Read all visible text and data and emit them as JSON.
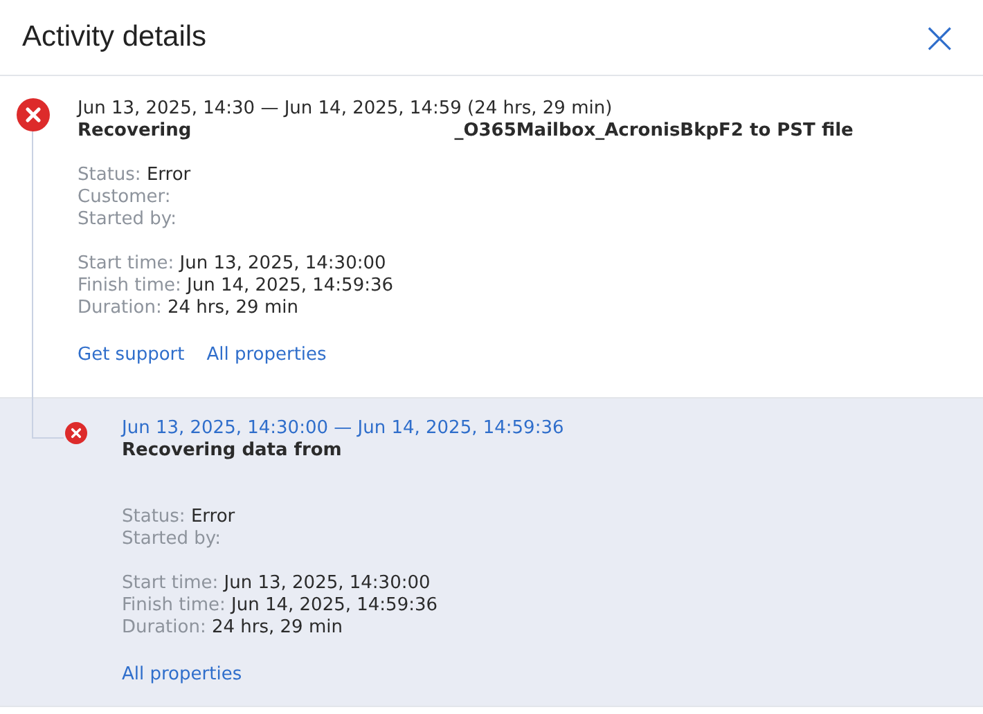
{
  "window": {
    "title": "Activity details",
    "close_icon": "×"
  },
  "activities": [
    {
      "kind": "parent",
      "color": "#dd2b2b",
      "selected": false,
      "period": "Jun 13, 2025, 14:30 — Jun 14, 2025, 14:59 (24 hrs, 29 min)",
      "title": "Recovering",
      "title_tail": "_O365Mailbox_AcronisBkpF2 to PST file",
      "groups": [
        [
          {
            "label": "Status:",
            "value": "Error"
          },
          {
            "label": "Customer:"
          },
          {
            "label": "Started by:"
          }
        ],
        [
          {
            "label": "Start time:",
            "value": "Jun 13, 2025, 14:30:00"
          },
          {
            "label": "Finish time:",
            "value": "Jun 14, 2025, 14:59:36"
          },
          {
            "label": "Duration:",
            "value": "24 hrs, 29 min"
          }
        ]
      ],
      "links": [
        "Get support",
        "All properties"
      ]
    },
    {
      "kind": "child",
      "color": "#dd2b2b",
      "selected": true,
      "period": "Jun 13, 2025, 14:30:00 — Jun 14, 2025, 14:59:36",
      "title": "Recovering data from",
      "groups": [
        [
          {
            "label": "Status:",
            "value": "Error"
          },
          {
            "label": "Started by:"
          }
        ],
        [
          {
            "label": "Start time:",
            "value": "Jun 13, 2025, 14:30:00"
          },
          {
            "label": "Finish time:",
            "value": "Jun 14, 2025, 14:59:36"
          },
          {
            "label": "Duration:",
            "value": "24 hrs, 29 min"
          }
        ]
      ],
      "links": [
        "All properties"
      ]
    }
  ]
}
